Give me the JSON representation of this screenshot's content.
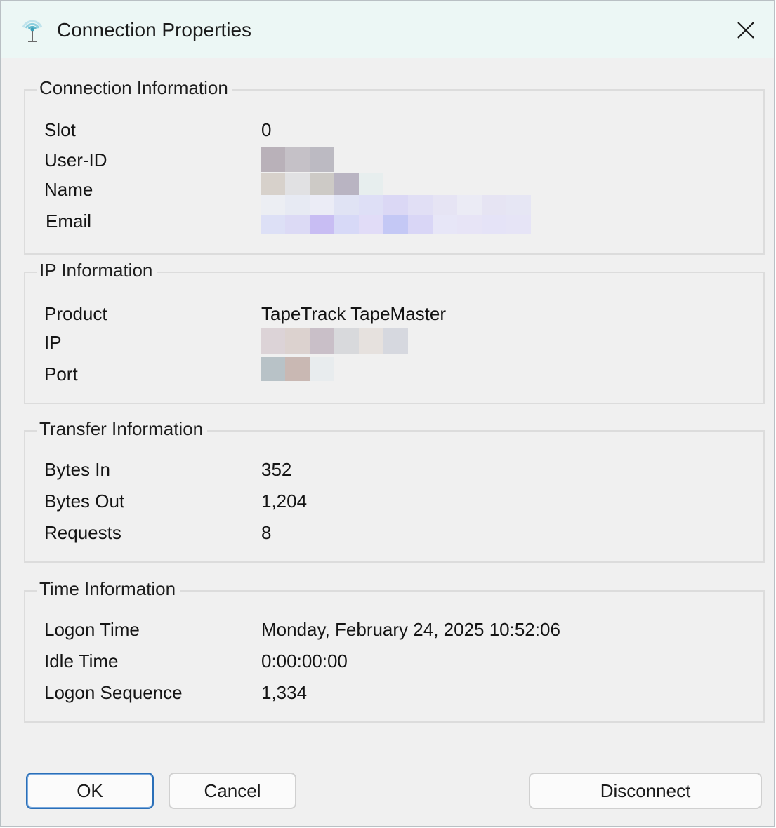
{
  "window": {
    "title": "Connection Properties",
    "icon": "antenna-icon",
    "close_icon": "close-icon"
  },
  "connection": {
    "legend": "Connection Information",
    "slot_label": "Slot",
    "slot_value": "0",
    "userid_label": "User-ID",
    "name_label": "Name",
    "email_label": "Email"
  },
  "ip": {
    "legend": "IP Information",
    "product_label": "Product",
    "product_value": "TapeTrack TapeMaster",
    "ip_label": "IP",
    "port_label": "Port"
  },
  "transfer": {
    "legend": "Transfer Information",
    "bytes_in_label": "Bytes In",
    "bytes_in_value": "352",
    "bytes_out_label": "Bytes Out",
    "bytes_out_value": "1,204",
    "requests_label": "Requests",
    "requests_value": "8"
  },
  "time": {
    "legend": "Time Information",
    "logon_time_label": "Logon Time",
    "logon_time_value": "Monday, February 24, 2025 10:52:06",
    "idle_time_label": "Idle Time",
    "idle_time_value": "0:00:00:00",
    "logon_sequence_label": "Logon Sequence",
    "logon_sequence_value": "1,334"
  },
  "buttons": {
    "ok": "OK",
    "cancel": "Cancel",
    "disconnect": "Disconnect"
  },
  "colors": {
    "titlebar": "#ecf7f5",
    "dialog_bg": "#f0f0f0",
    "default_button_border": "#2a6fb8"
  },
  "redacted": {
    "userid": [
      [
        "#b9b1b9",
        "#c5c1c7",
        "#bcbac2"
      ]
    ],
    "name": [
      [
        "#d7d1cb",
        "#e1e1e3",
        "#cdcac6",
        "#b9b4c2",
        "#e7eeee"
      ]
    ],
    "email": [
      [
        "#eceef3",
        "#e7eaf3",
        "#ebecf6",
        "#e0e3f4",
        "#dedff6",
        "#dbd8f5",
        "#e1dff5",
        "#e6e4f4",
        "#ebebf5",
        "#e6e4f3",
        "#e6e6f4"
      ],
      [
        "#dde0f6",
        "#dcdaf5",
        "#c8bdf3",
        "#d7d9f7",
        "#e1dcf7",
        "#c4c8f5",
        "#d9d6f6",
        "#e7e6f7",
        "#e7e4f6",
        "#e5e3f7",
        "#e6e4f6"
      ]
    ],
    "ip": [
      [
        "#dcd3d7",
        "#dcd2cf",
        "#c9bfc8",
        "#d8d9dc",
        "#e6e1de",
        "#d6d8df"
      ]
    ],
    "port": [
      [
        "#b8c2c7",
        "#c9b8b3",
        "#e8ecee"
      ]
    ]
  }
}
